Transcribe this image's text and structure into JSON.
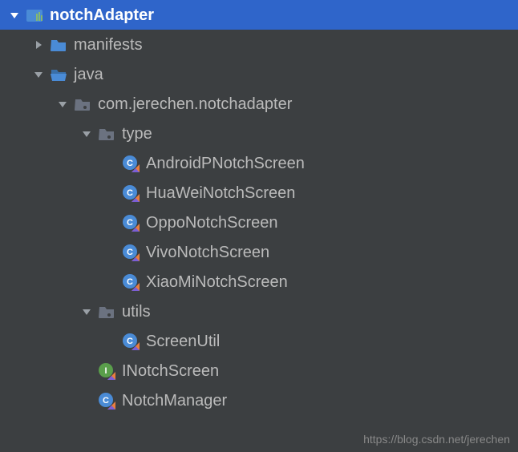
{
  "tree": {
    "root": {
      "label": "notchAdapter",
      "expanded": true
    },
    "items": [
      {
        "label": "manifests",
        "kind": "folder-closed",
        "expanded": false,
        "depth": 1,
        "hasChildren": true
      },
      {
        "label": "java",
        "kind": "folder-open",
        "expanded": true,
        "depth": 1,
        "hasChildren": true
      },
      {
        "label": "com.jerechen.notchadapter",
        "kind": "package",
        "expanded": true,
        "depth": 2,
        "hasChildren": true
      },
      {
        "label": "type",
        "kind": "package",
        "expanded": true,
        "depth": 3,
        "hasChildren": true
      },
      {
        "label": "AndroidPNotchScreen",
        "kind": "kotlin-class",
        "depth": 4,
        "hasChildren": false
      },
      {
        "label": "HuaWeiNotchScreen",
        "kind": "kotlin-class",
        "depth": 4,
        "hasChildren": false
      },
      {
        "label": "OppoNotchScreen",
        "kind": "kotlin-class",
        "depth": 4,
        "hasChildren": false
      },
      {
        "label": "VivoNotchScreen",
        "kind": "kotlin-class",
        "depth": 4,
        "hasChildren": false
      },
      {
        "label": "XiaoMiNotchScreen",
        "kind": "kotlin-class",
        "depth": 4,
        "hasChildren": false
      },
      {
        "label": "utils",
        "kind": "package",
        "expanded": true,
        "depth": 3,
        "hasChildren": true
      },
      {
        "label": "ScreenUtil",
        "kind": "kotlin-class",
        "depth": 4,
        "hasChildren": false
      },
      {
        "label": "INotchScreen",
        "kind": "kotlin-interface",
        "depth": 3,
        "hasChildren": false
      },
      {
        "label": "NotchManager",
        "kind": "kotlin-class",
        "depth": 3,
        "hasChildren": false
      }
    ]
  },
  "watermark": "https://blog.csdn.net/jerechen"
}
